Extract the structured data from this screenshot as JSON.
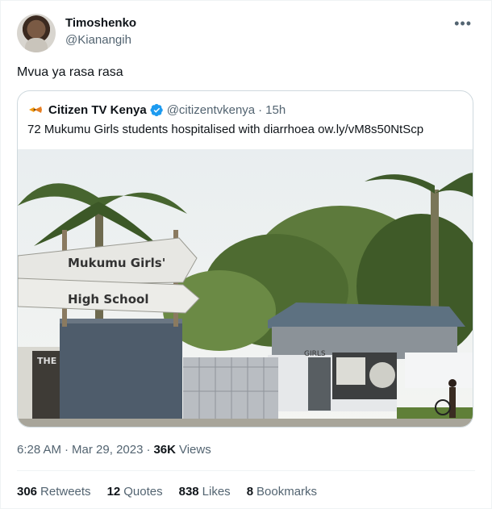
{
  "tweet": {
    "author_name": "Timoshenko",
    "author_handle": "@Kianangih",
    "more_glyph": "•••",
    "text": "Mvua ya rasa rasa"
  },
  "quoted": {
    "author_name": "Citizen TV Kenya",
    "author_handle": "@citizentvkenya",
    "separator": "·",
    "time": "15h",
    "text": "72 Mukumu Girls students hospitalised with diarrhoea ow.ly/vM8s50NtScp",
    "image": {
      "sign_top": "Mukumu Girls'",
      "sign_bottom": "High School",
      "gate_label_left": "THE",
      "gate_label_right": "GIRLS"
    }
  },
  "meta": {
    "time": "6:28 AM",
    "separator1": "·",
    "date": "Mar 29, 2023",
    "separator2": "·",
    "views_count": "36K",
    "views_label": "Views"
  },
  "stats": [
    {
      "count": "306",
      "label": "Retweets"
    },
    {
      "count": "12",
      "label": "Quotes"
    },
    {
      "count": "838",
      "label": "Likes"
    },
    {
      "count": "8",
      "label": "Bookmarks"
    }
  ],
  "colors": {
    "verified": "#1d9bf0",
    "secondary_text": "#536471",
    "primary_text": "#0f1419"
  }
}
